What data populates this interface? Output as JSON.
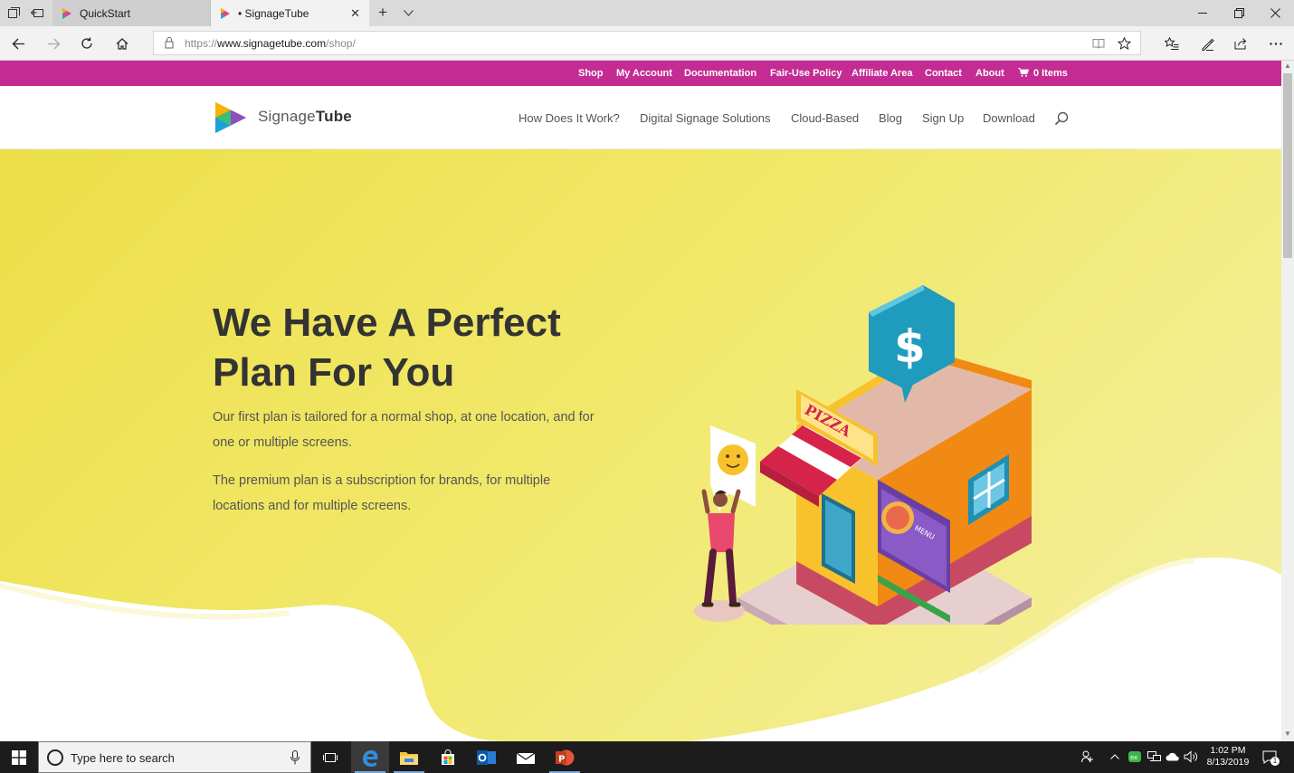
{
  "browser": {
    "tabs": [
      {
        "label": "QuickStart",
        "active": false
      },
      {
        "label": "• SignageTube",
        "active": true
      }
    ],
    "address": {
      "scheme": "https://",
      "domain": "www.signagetube.com",
      "path": "/shop/"
    }
  },
  "site": {
    "top_links": [
      "Shop",
      "My Account",
      "Documentation",
      "Fair-Use Policy",
      "Affiliate Area",
      "Contact",
      "About"
    ],
    "cart_label": "0 Items",
    "logo": {
      "light": "Signage",
      "bold": "Tube"
    },
    "menu": [
      "How Does It Work?",
      "Digital Signage Solutions",
      "Cloud-Based",
      "Blog",
      "Sign Up",
      "Download"
    ],
    "colors": {
      "topbar": "#c42c94",
      "hero_start": "#ecdf48",
      "hero_end": "#f5f0a5"
    }
  },
  "hero": {
    "title_line1": "We Have A Perfect",
    "title_line2": "Plan For You",
    "p1_line1": "Our first plan is tailored for a normal shop, at one location, and for",
    "p1_line2": "one or multiple screens.",
    "p2_line1": "The premium plan is a subscription for brands, for multiple",
    "p2_line2": "locations and for multiple screens.",
    "illustration": {
      "sign": "PIZZA",
      "bubble_symbol": "$",
      "menu_text": "MENU"
    }
  },
  "taskbar": {
    "search_placeholder": "Type here to search",
    "time": "1:02 PM",
    "date": "8/13/2019",
    "notification_count": "1"
  }
}
